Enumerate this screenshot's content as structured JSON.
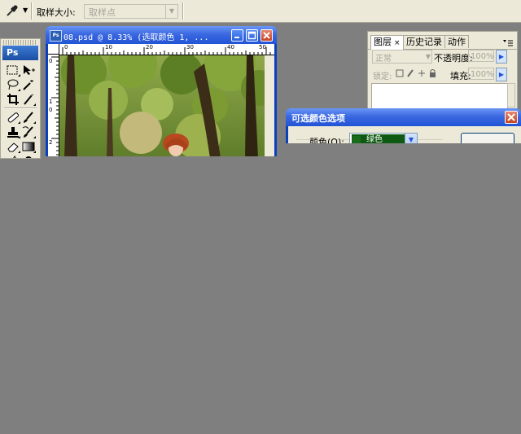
{
  "options_bar": {
    "tool_icon": "eyedropper-icon",
    "sample_size_label": "取样大小:",
    "sample_size_value": "取样点"
  },
  "toolbox": {
    "logo": "Ps",
    "tools": [
      "marquee-icon",
      "move-icon",
      "lasso-icon",
      "magic-wand-icon",
      "crop-icon",
      "slice-icon",
      "healing-brush-icon",
      "brush-icon",
      "clone-stamp-icon",
      "history-brush-icon",
      "eraser-icon",
      "gradient-icon"
    ]
  },
  "document": {
    "icon_text": "Ps",
    "title": "08.psd @ 8.33% (选取颜色 1, ...",
    "ruler_h": [
      "0",
      "10",
      "20",
      "30",
      "40",
      "50"
    ],
    "ruler_v": [
      "0",
      "1",
      "0",
      "2"
    ]
  },
  "layers_panel": {
    "tabs": [
      {
        "label": "图层",
        "close": "×"
      },
      {
        "label": "历史记录"
      },
      {
        "label": "动作"
      }
    ],
    "menu_icon": "panel-menu-icon",
    "blend_mode": "正常",
    "opacity_label": "不透明度:",
    "opacity_value": "100%",
    "lock_label": "锁定:",
    "fill_label": "填充:",
    "fill_value": "100%"
  },
  "dialog": {
    "title": "可选颜色选项",
    "color_label": "颜色(O):",
    "color_value": "绿色",
    "color_swatch": "#1a6b1a"
  }
}
